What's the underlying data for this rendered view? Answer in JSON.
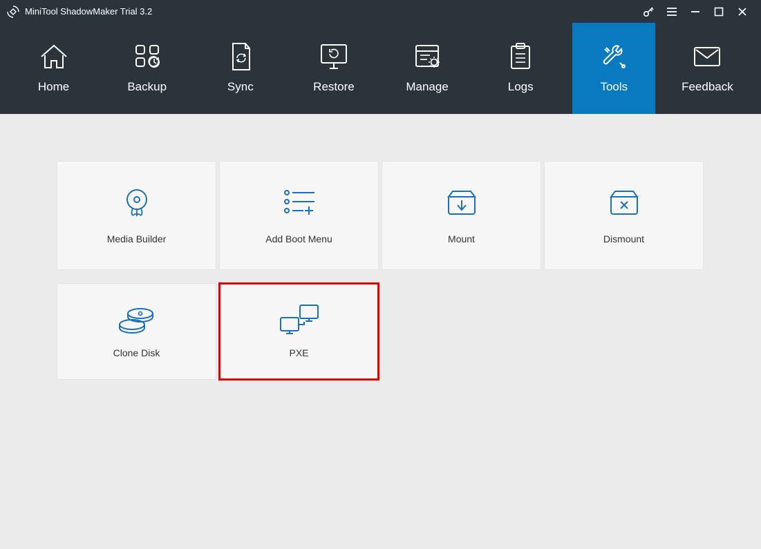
{
  "app": {
    "title": "MiniTool ShadowMaker Trial 3.2"
  },
  "nav": {
    "home": "Home",
    "backup": "Backup",
    "sync": "Sync",
    "restore": "Restore",
    "manage": "Manage",
    "logs": "Logs",
    "tools": "Tools",
    "feedback": "Feedback"
  },
  "tools": {
    "media_builder": "Media Builder",
    "add_boot_menu": "Add Boot Menu",
    "mount": "Mount",
    "dismount": "Dismount",
    "clone_disk": "Clone Disk",
    "pxe": "PXE"
  }
}
